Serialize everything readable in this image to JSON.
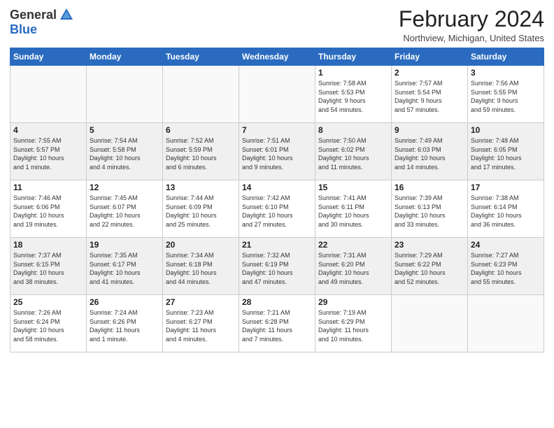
{
  "header": {
    "logo_general": "General",
    "logo_blue": "Blue",
    "title": "February 2024",
    "subtitle": "Northview, Michigan, United States"
  },
  "days_of_week": [
    "Sunday",
    "Monday",
    "Tuesday",
    "Wednesday",
    "Thursday",
    "Friday",
    "Saturday"
  ],
  "weeks": [
    {
      "shaded": false,
      "days": [
        {
          "num": "",
          "info": ""
        },
        {
          "num": "",
          "info": ""
        },
        {
          "num": "",
          "info": ""
        },
        {
          "num": "",
          "info": ""
        },
        {
          "num": "1",
          "info": "Sunrise: 7:58 AM\nSunset: 5:53 PM\nDaylight: 9 hours\nand 54 minutes."
        },
        {
          "num": "2",
          "info": "Sunrise: 7:57 AM\nSunset: 5:54 PM\nDaylight: 9 hours\nand 57 minutes."
        },
        {
          "num": "3",
          "info": "Sunrise: 7:56 AM\nSunset: 5:55 PM\nDaylight: 9 hours\nand 59 minutes."
        }
      ]
    },
    {
      "shaded": true,
      "days": [
        {
          "num": "4",
          "info": "Sunrise: 7:55 AM\nSunset: 5:57 PM\nDaylight: 10 hours\nand 1 minute."
        },
        {
          "num": "5",
          "info": "Sunrise: 7:54 AM\nSunset: 5:58 PM\nDaylight: 10 hours\nand 4 minutes."
        },
        {
          "num": "6",
          "info": "Sunrise: 7:52 AM\nSunset: 5:59 PM\nDaylight: 10 hours\nand 6 minutes."
        },
        {
          "num": "7",
          "info": "Sunrise: 7:51 AM\nSunset: 6:01 PM\nDaylight: 10 hours\nand 9 minutes."
        },
        {
          "num": "8",
          "info": "Sunrise: 7:50 AM\nSunset: 6:02 PM\nDaylight: 10 hours\nand 11 minutes."
        },
        {
          "num": "9",
          "info": "Sunrise: 7:49 AM\nSunset: 6:03 PM\nDaylight: 10 hours\nand 14 minutes."
        },
        {
          "num": "10",
          "info": "Sunrise: 7:48 AM\nSunset: 6:05 PM\nDaylight: 10 hours\nand 17 minutes."
        }
      ]
    },
    {
      "shaded": false,
      "days": [
        {
          "num": "11",
          "info": "Sunrise: 7:46 AM\nSunset: 6:06 PM\nDaylight: 10 hours\nand 19 minutes."
        },
        {
          "num": "12",
          "info": "Sunrise: 7:45 AM\nSunset: 6:07 PM\nDaylight: 10 hours\nand 22 minutes."
        },
        {
          "num": "13",
          "info": "Sunrise: 7:44 AM\nSunset: 6:09 PM\nDaylight: 10 hours\nand 25 minutes."
        },
        {
          "num": "14",
          "info": "Sunrise: 7:42 AM\nSunset: 6:10 PM\nDaylight: 10 hours\nand 27 minutes."
        },
        {
          "num": "15",
          "info": "Sunrise: 7:41 AM\nSunset: 6:11 PM\nDaylight: 10 hours\nand 30 minutes."
        },
        {
          "num": "16",
          "info": "Sunrise: 7:39 AM\nSunset: 6:13 PM\nDaylight: 10 hours\nand 33 minutes."
        },
        {
          "num": "17",
          "info": "Sunrise: 7:38 AM\nSunset: 6:14 PM\nDaylight: 10 hours\nand 36 minutes."
        }
      ]
    },
    {
      "shaded": true,
      "days": [
        {
          "num": "18",
          "info": "Sunrise: 7:37 AM\nSunset: 6:15 PM\nDaylight: 10 hours\nand 38 minutes."
        },
        {
          "num": "19",
          "info": "Sunrise: 7:35 AM\nSunset: 6:17 PM\nDaylight: 10 hours\nand 41 minutes."
        },
        {
          "num": "20",
          "info": "Sunrise: 7:34 AM\nSunset: 6:18 PM\nDaylight: 10 hours\nand 44 minutes."
        },
        {
          "num": "21",
          "info": "Sunrise: 7:32 AM\nSunset: 6:19 PM\nDaylight: 10 hours\nand 47 minutes."
        },
        {
          "num": "22",
          "info": "Sunrise: 7:31 AM\nSunset: 6:20 PM\nDaylight: 10 hours\nand 49 minutes."
        },
        {
          "num": "23",
          "info": "Sunrise: 7:29 AM\nSunset: 6:22 PM\nDaylight: 10 hours\nand 52 minutes."
        },
        {
          "num": "24",
          "info": "Sunrise: 7:27 AM\nSunset: 6:23 PM\nDaylight: 10 hours\nand 55 minutes."
        }
      ]
    },
    {
      "shaded": false,
      "days": [
        {
          "num": "25",
          "info": "Sunrise: 7:26 AM\nSunset: 6:24 PM\nDaylight: 10 hours\nand 58 minutes."
        },
        {
          "num": "26",
          "info": "Sunrise: 7:24 AM\nSunset: 6:26 PM\nDaylight: 11 hours\nand 1 minute."
        },
        {
          "num": "27",
          "info": "Sunrise: 7:23 AM\nSunset: 6:27 PM\nDaylight: 11 hours\nand 4 minutes."
        },
        {
          "num": "28",
          "info": "Sunrise: 7:21 AM\nSunset: 6:28 PM\nDaylight: 11 hours\nand 7 minutes."
        },
        {
          "num": "29",
          "info": "Sunrise: 7:19 AM\nSunset: 6:29 PM\nDaylight: 11 hours\nand 10 minutes."
        },
        {
          "num": "",
          "info": ""
        },
        {
          "num": "",
          "info": ""
        }
      ]
    }
  ]
}
